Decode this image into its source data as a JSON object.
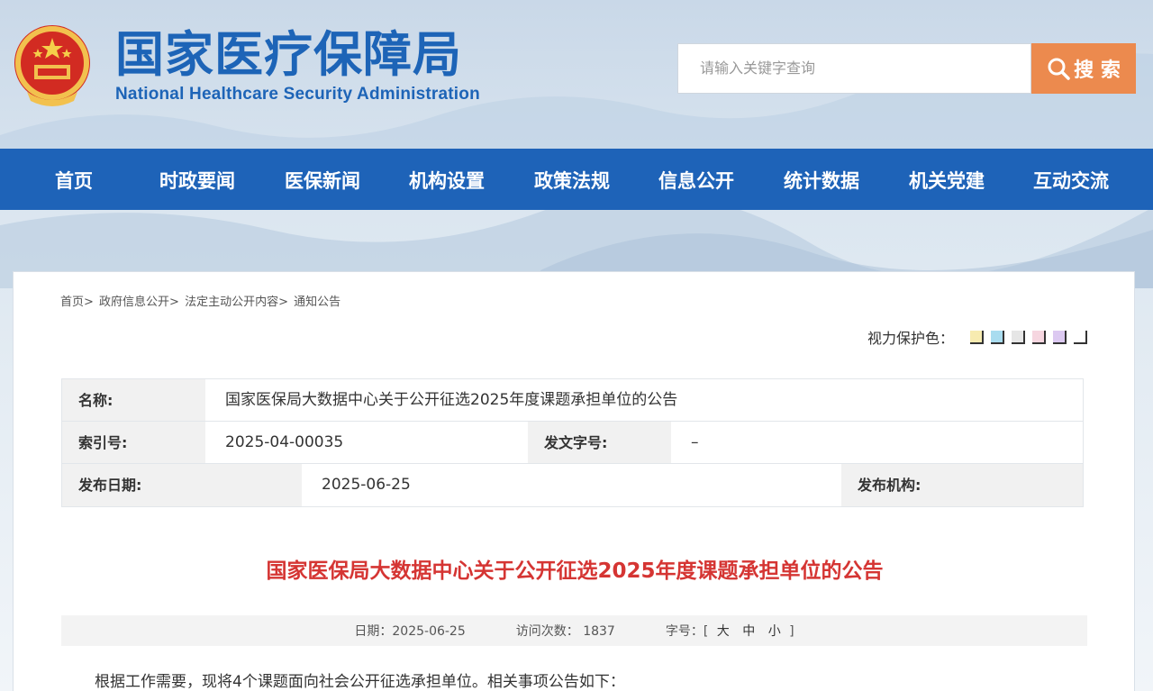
{
  "header": {
    "title_cn": "国家医疗保障局",
    "title_en": "National Healthcare Security Administration",
    "search_placeholder": "请输入关键字查询",
    "search_label": "搜 索"
  },
  "nav": [
    "首页",
    "时政要闻",
    "医保新闻",
    "机构设置",
    "政策法规",
    "信息公开",
    "统计数据",
    "机关党建",
    "互动交流"
  ],
  "breadcrumb": [
    "首页>",
    "政府信息公开>",
    "法定主动公开内容>",
    "通知公告"
  ],
  "eye_protect": {
    "label": "视力保护色：",
    "colors": [
      "#f7ebb0",
      "#a9dcef",
      "#e6e6e6",
      "#f6d6e0",
      "#dcc9f1",
      "#ffffff"
    ]
  },
  "info": {
    "name_label": "名称:",
    "name_value": "国家医保局大数据中心关于公开征选2025年度课题承担单位的公告",
    "index_label": "索引号:",
    "index_value": "2025-04-00035",
    "docno_label": "发文字号:",
    "docno_value": "–",
    "date_label": "发布日期:",
    "date_value": "2025-06-25",
    "org_label": "发布机构:",
    "org_value": ""
  },
  "article": {
    "title": "国家医保局大数据中心关于公开征选2025年度课题承担单位的公告",
    "meta_date": "日期：2025-06-25",
    "meta_visits": "访问次数： 1837",
    "meta_fontsize_label": "字号：[",
    "meta_fs_large": "大",
    "meta_fs_medium": "中",
    "meta_fs_small": "小",
    "meta_fs_close": "]",
    "body_first_line": "根据工作需要，现将4个课题面向社会公开征选承担单位。相关事项公告如下："
  },
  "colors": {
    "brand_blue": "#1e63b8",
    "accent_orange": "#ec8a4e",
    "title_red": "#d53533"
  }
}
